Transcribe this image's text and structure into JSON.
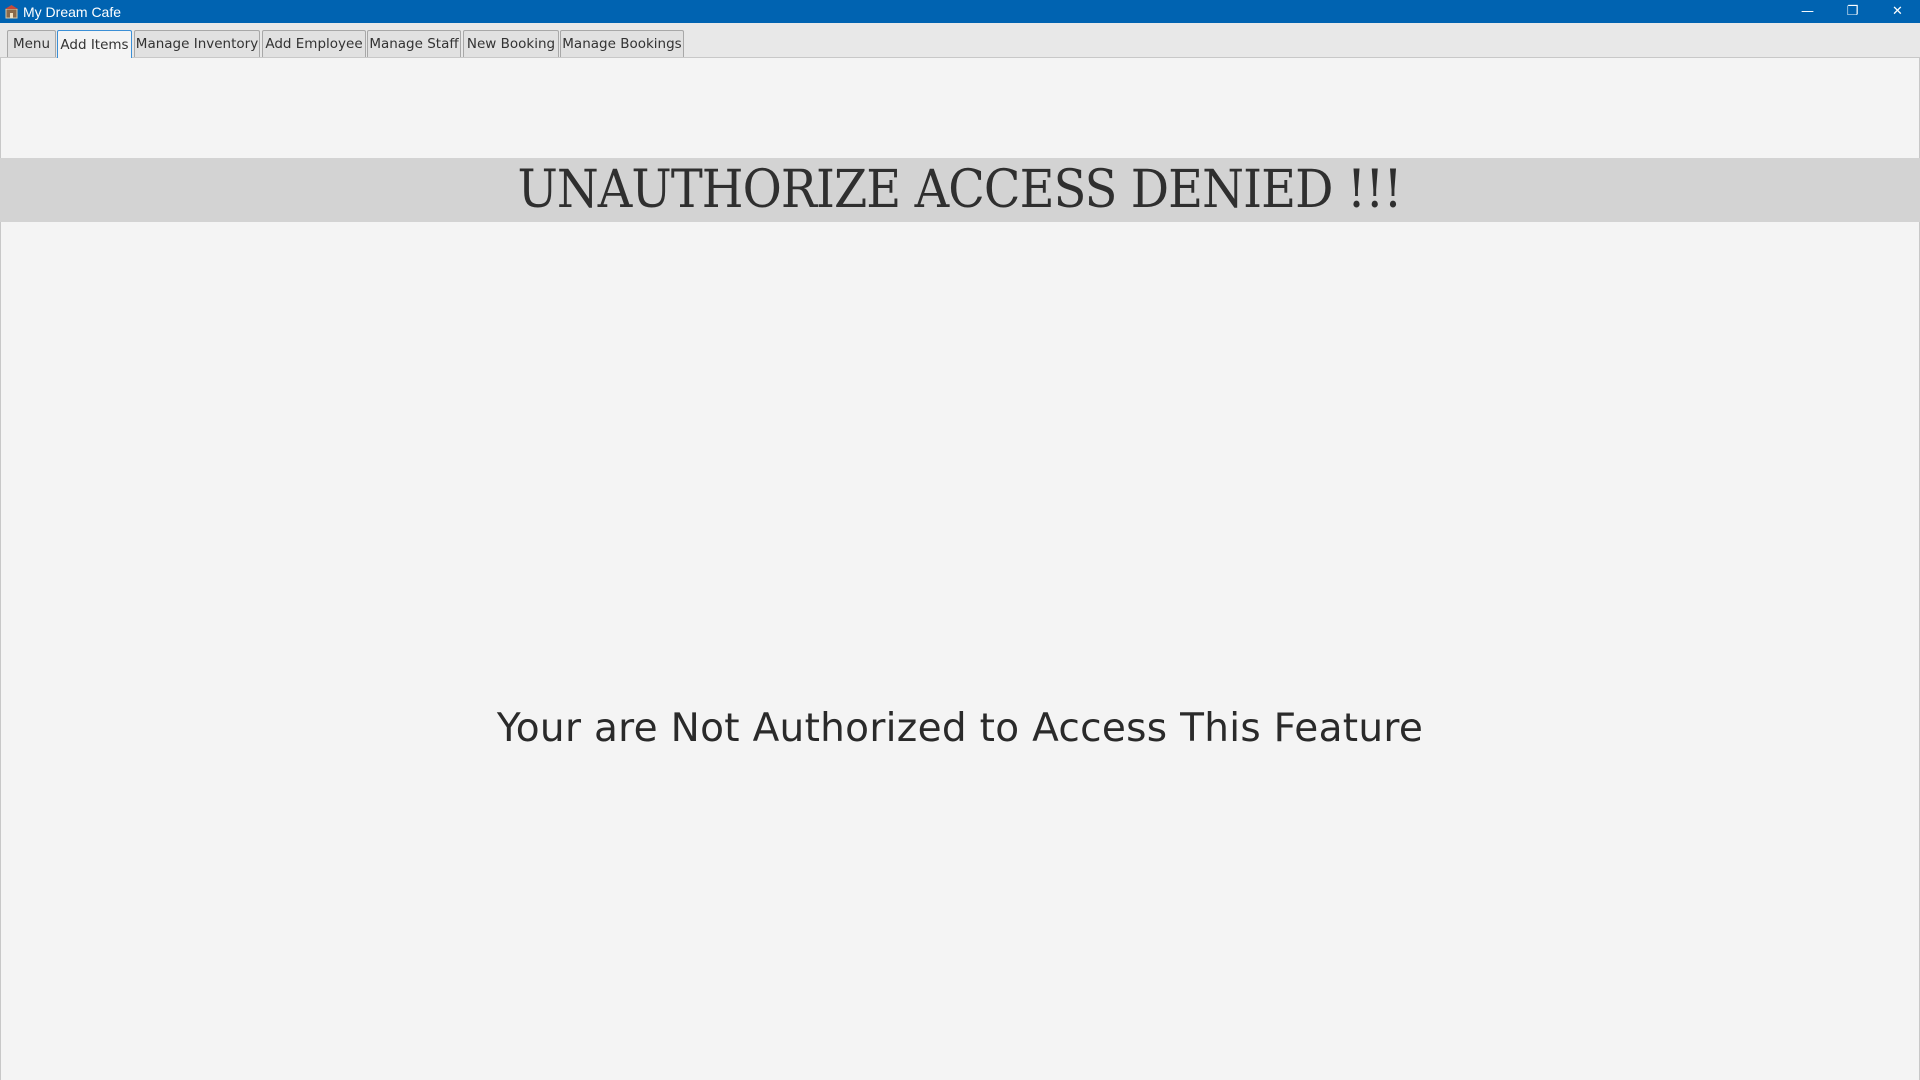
{
  "window": {
    "title": "My Dream Cafe",
    "icon": "app-icon",
    "controls": {
      "minimize": "—",
      "restore": "❐",
      "close": "✕"
    }
  },
  "tabs": [
    {
      "label": "Menu",
      "active": false
    },
    {
      "label": "Add Items",
      "active": true
    },
    {
      "label": "Manage Inventory",
      "active": false
    },
    {
      "label": "Add Employee",
      "active": false
    },
    {
      "label": "Manage Staff",
      "active": false
    },
    {
      "label": "New Booking",
      "active": false
    },
    {
      "label": "Manage Bookings",
      "active": false
    }
  ],
  "main": {
    "banner_text": "UNAUTHORIZE ACCESS DENIED !!!",
    "message": "Your are Not Authorized to Access This Feature"
  },
  "colors": {
    "titlebar": "#0063b1",
    "active_tab_border": "#3b8fd6",
    "banner_bg": "#d3d3d3"
  }
}
